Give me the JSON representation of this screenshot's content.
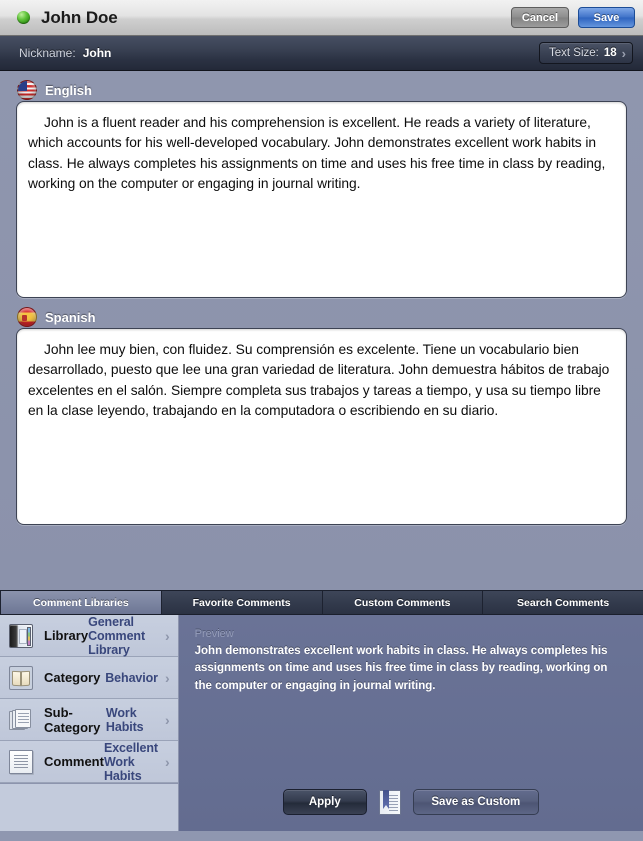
{
  "titlebar": {
    "status_icon": "green-status-dot",
    "title": "John Doe",
    "cancel_label": "Cancel",
    "save_label": "Save"
  },
  "nicknamebar": {
    "label": "Nickname:",
    "value": "John",
    "textsize_label": "Text Size:",
    "textsize_value": "18",
    "chevron": "›"
  },
  "english_section": {
    "flag_icon": "us-flag-icon",
    "language": "English",
    "text": "John is a fluent reader and his comprehension is excellent.  He reads a variety of literature, which accounts for his well-developed vocabulary.  John demonstrates excellent work habits in class.  He always completes his assignments on time and uses his free time in class by reading, working on the computer or engaging in journal writing."
  },
  "spanish_section": {
    "flag_icon": "spain-flag-icon",
    "language": "Spanish",
    "text": "John lee muy bien, con fluidez.  Su comprensión es excelente.  Tiene un vocabulario bien desarrollado, puesto que lee una gran variedad de literatura.  John demuestra hábitos de trabajo excelentes en el salón.  Siempre completa sus trabajos y tareas a tiempo, y usa su tiempo libre en la clase leyendo, trabajando en la computadora o escribiendo en su diario."
  },
  "tabs": [
    {
      "label": "Comment Libraries",
      "active": true
    },
    {
      "label": "Favorite Comments",
      "active": false
    },
    {
      "label": "Custom Comments",
      "active": false
    },
    {
      "label": "Search Comments",
      "active": false
    }
  ],
  "rows": [
    {
      "icon": "library-binder-icon",
      "label": "Library",
      "value": "General Comment Library",
      "chevron": "›"
    },
    {
      "icon": "open-book-icon",
      "label": "Category",
      "value": "Behavior",
      "chevron": "›"
    },
    {
      "icon": "stacked-pages-icon",
      "label": "Sub-Category",
      "value": "Work Habits",
      "chevron": "›"
    },
    {
      "icon": "document-icon",
      "label": "Comment",
      "value": "Excellent Work Habits",
      "chevron": "›"
    }
  ],
  "preview": {
    "label": "Preview",
    "text": "John demonstrates excellent work habits in class. He always completes his assignments on time and uses his free time in class by reading, working on the computer or engaging in journal writing.",
    "apply_label": "Apply",
    "bookmark_icon": "book-bookmark-icon",
    "save_custom_label": "Save as Custom"
  },
  "colors": {
    "accent_blue": "#39477c",
    "save_button": "#2f64c0",
    "status_green": "#2e8e14",
    "body_background": "#8f96ae",
    "rows_background": "#c3cbdc",
    "preview_background": "#6a7396",
    "dark_bar": "#2b3243"
  }
}
